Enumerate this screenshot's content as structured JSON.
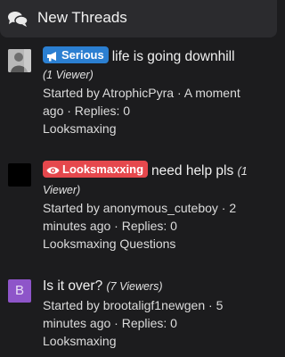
{
  "header": {
    "title": "New Threads",
    "icon": "comments-icon"
  },
  "threads": [
    {
      "avatar": "user-photo",
      "prefix": "Serious",
      "prefix_icon": "megaphone-icon",
      "prefix_color": "#2b7fd1",
      "title": "life is going downhill",
      "viewers": "(1 Viewer)",
      "started_by": "Started by AtrophicPyra · A moment",
      "started_by_line2": "ago · Replies: 0",
      "forum": "Looksmaxing"
    },
    {
      "avatar": "black-square",
      "prefix": "Looksmaxxing",
      "prefix_icon": "eye-icon",
      "prefix_color": "#e5484d",
      "title": "need help pls",
      "viewers_line1": "(1",
      "viewers_line2": "Viewer)",
      "started_by": "Started by anonymous_cuteboy · 2",
      "started_by_line2": "minutes ago · Replies: 0",
      "forum": "Looksmaxing Questions"
    },
    {
      "avatar_letter": "B",
      "avatar_color": "#8e55c9",
      "title": "Is it over?",
      "viewers": "(7 Viewers)",
      "started_by": "Started by brootaligf1newgen · 5",
      "started_by_line2": "minutes ago · Replies: 0",
      "forum": "Looksmaxing"
    }
  ]
}
